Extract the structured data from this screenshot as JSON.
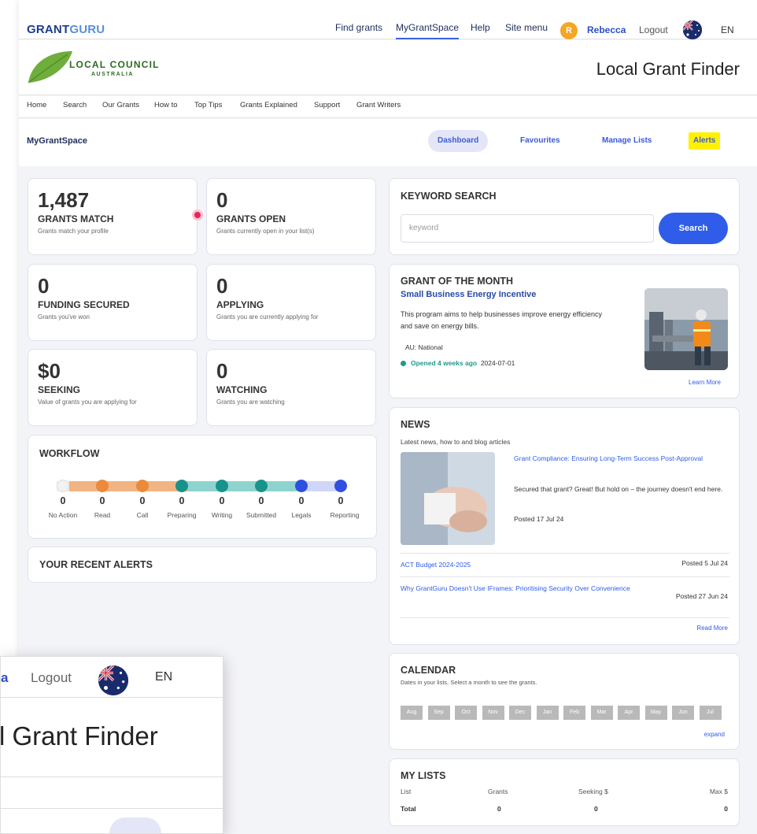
{
  "topbar": {
    "logo_part1": "GRANT",
    "logo_part2": "GURU",
    "nav": [
      "Find grants",
      "MyGrantSpace",
      "Help",
      "Site menu"
    ],
    "avatar_initial": "R",
    "user_name": "Rebecca",
    "logout": "Logout",
    "lang": "EN"
  },
  "brand": {
    "council_name": "LOCAL COUNCIL",
    "council_sub": "AUSTRALIA",
    "site_title": "Local Grant Finder"
  },
  "subnav": [
    "Home",
    "Search",
    "Our Grants",
    "How to",
    "Top Tips",
    "Grants Explained",
    "Support",
    "Grant Writers"
  ],
  "mygrantspace": {
    "title": "MyGrantSpace",
    "tabs": [
      "Dashboard",
      "Favourites",
      "Manage Lists",
      "Alerts"
    ],
    "active_tab": "Dashboard",
    "highlight_tab": "Alerts"
  },
  "stats": [
    {
      "value": "1,487",
      "label": "GRANTS MATCH",
      "sub": "Grants match your profile"
    },
    {
      "value": "0",
      "label": "GRANTS OPEN",
      "sub": "Grants currently open in your list(s)"
    },
    {
      "value": "0",
      "label": "FUNDING SECURED",
      "sub": "Grants you've won"
    },
    {
      "value": "0",
      "label": "APPLYING",
      "sub": "Grants you are currently applying for"
    },
    {
      "value": "$0",
      "label": "SEEKING",
      "sub": "Value of grants you are applying for"
    },
    {
      "value": "0",
      "label": "WATCHING",
      "sub": "Grants you are watching"
    }
  ],
  "workflow": {
    "title": "WORKFLOW",
    "stages": [
      {
        "label": "No Action",
        "count": "0"
      },
      {
        "label": "Read",
        "count": "0"
      },
      {
        "label": "Call",
        "count": "0"
      },
      {
        "label": "Preparing",
        "count": "0"
      },
      {
        "label": "Writing",
        "count": "0"
      },
      {
        "label": "Submitted",
        "count": "0"
      },
      {
        "label": "Legals",
        "count": "0"
      },
      {
        "label": "Reporting",
        "count": "0"
      }
    ],
    "colors": {
      "none": "#e8e8e8",
      "orange": "#f1b482",
      "orange_dot": "#ec8a3c",
      "teal": "#8fd3d0",
      "teal_dot": "#17938a",
      "blue": "#cfd6f7",
      "blue_dot": "#2f4fe0"
    }
  },
  "recent_alerts": {
    "title": "YOUR RECENT ALERTS"
  },
  "keyword_search": {
    "title": "KEYWORD SEARCH",
    "placeholder": "keyword",
    "button": "Search"
  },
  "grant_of_month": {
    "title": "GRANT OF THE MONTH",
    "grant_name": "Small Business Energy Incentive",
    "description": "This program aims to help businesses improve energy efficiency and save on energy bills.",
    "region": "AU: National",
    "status": "Opened 4 weeks ago",
    "date": "2024-07-01",
    "link": "Learn More"
  },
  "news": {
    "title": "NEWS",
    "subtitle": "Latest news, how to and blog articles",
    "feature": {
      "title": "Grant Compliance: Ensuring Long-Term Success Post-Approval",
      "text": "Secured that grant? Great! But hold on – the journey doesn't end here.",
      "date": "Posted 17 Jul 24"
    },
    "items": [
      {
        "title": "ACT Budget 2024-2025",
        "date": "Posted 5 Jul 24"
      },
      {
        "title": "Why GrantGuru Doesn't Use IFrames: Prioritising Security Over Convenience",
        "date": "Posted 27 Jun 24"
      }
    ],
    "read_more": "Read More"
  },
  "calendar": {
    "title": "CALENDAR",
    "subtitle": "Dates in your lists. Select a month to see the grants.",
    "months": [
      "Aug",
      "Sep",
      "Oct",
      "Nov",
      "Dec",
      "Jan",
      "Feb",
      "Mar",
      "Apr",
      "May",
      "Jun",
      "Jul"
    ],
    "expand": "expand"
  },
  "my_lists": {
    "title": "MY LISTS",
    "headers": [
      "List",
      "Grants",
      "Seeking $",
      "Max $"
    ],
    "total_row": [
      "Total",
      "0",
      "0",
      "0"
    ]
  },
  "zoom": {
    "user_fragment": "a",
    "logout": "Logout",
    "lang": "EN",
    "title_fragment": "l Grant Finder"
  }
}
